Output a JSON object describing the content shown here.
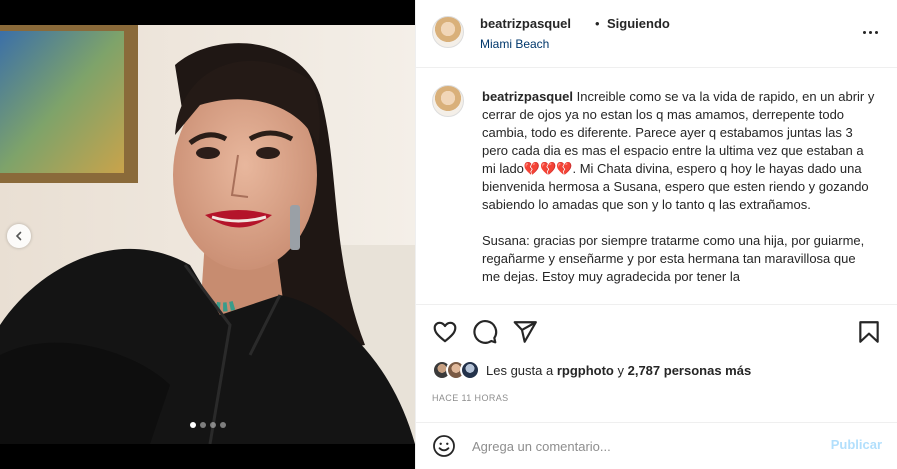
{
  "post": {
    "username": "beatrizpasquel",
    "separator": "•",
    "follow_label": "Siguiendo",
    "location": "Miami Beach",
    "media": {
      "carousel_dots": 4,
      "active_dot": 0,
      "prev_icon": "chevron-left-icon"
    },
    "caption": {
      "username": "beatrizpasquel",
      "text_part1": " Increible como se va la vida de rapido, en un abrir y cerrar de ojos ya no estan los q mas amamos, derrepente todo cambia, todo es diferente. Parece ayer q estabamos juntas las 3 pero cada dia es mas el espacio entre la ultima vez que estaban a mi lado",
      "hearts": "💔💔💔",
      "text_part2": ". Mi Chata divina, espero q hoy le hayas dado una bienvenida hermosa a Susana, espero que esten riendo y gozando sabiendo lo amadas que son y lo tanto q las extrañamos.\n\nSusana: gracias por siempre tratarme como una hija, por guiarme, regañarme y enseñarme y por esta hermana tan maravillosa que me dejas. Estoy muy agradecida por tener la"
    },
    "actions": {
      "like_icon": "heart-icon",
      "comment_icon": "comment-icon",
      "share_icon": "send-icon",
      "save_icon": "bookmark-icon"
    },
    "likes": {
      "prefix": "Les gusta a ",
      "first_user": "rpgphoto",
      "middle": " y ",
      "others": "2,787 personas más"
    },
    "timestamp": "HACE 11 HORAS",
    "comment": {
      "emoji_icon": "smiley-icon",
      "placeholder": "Agrega un comentario...",
      "publish_label": "Publicar"
    },
    "colors": {
      "link": "#00376b",
      "publish_disabled": "#b2dffc",
      "muted": "#8e8e8e",
      "text": "#262626",
      "heart": "#c20b2c"
    }
  }
}
